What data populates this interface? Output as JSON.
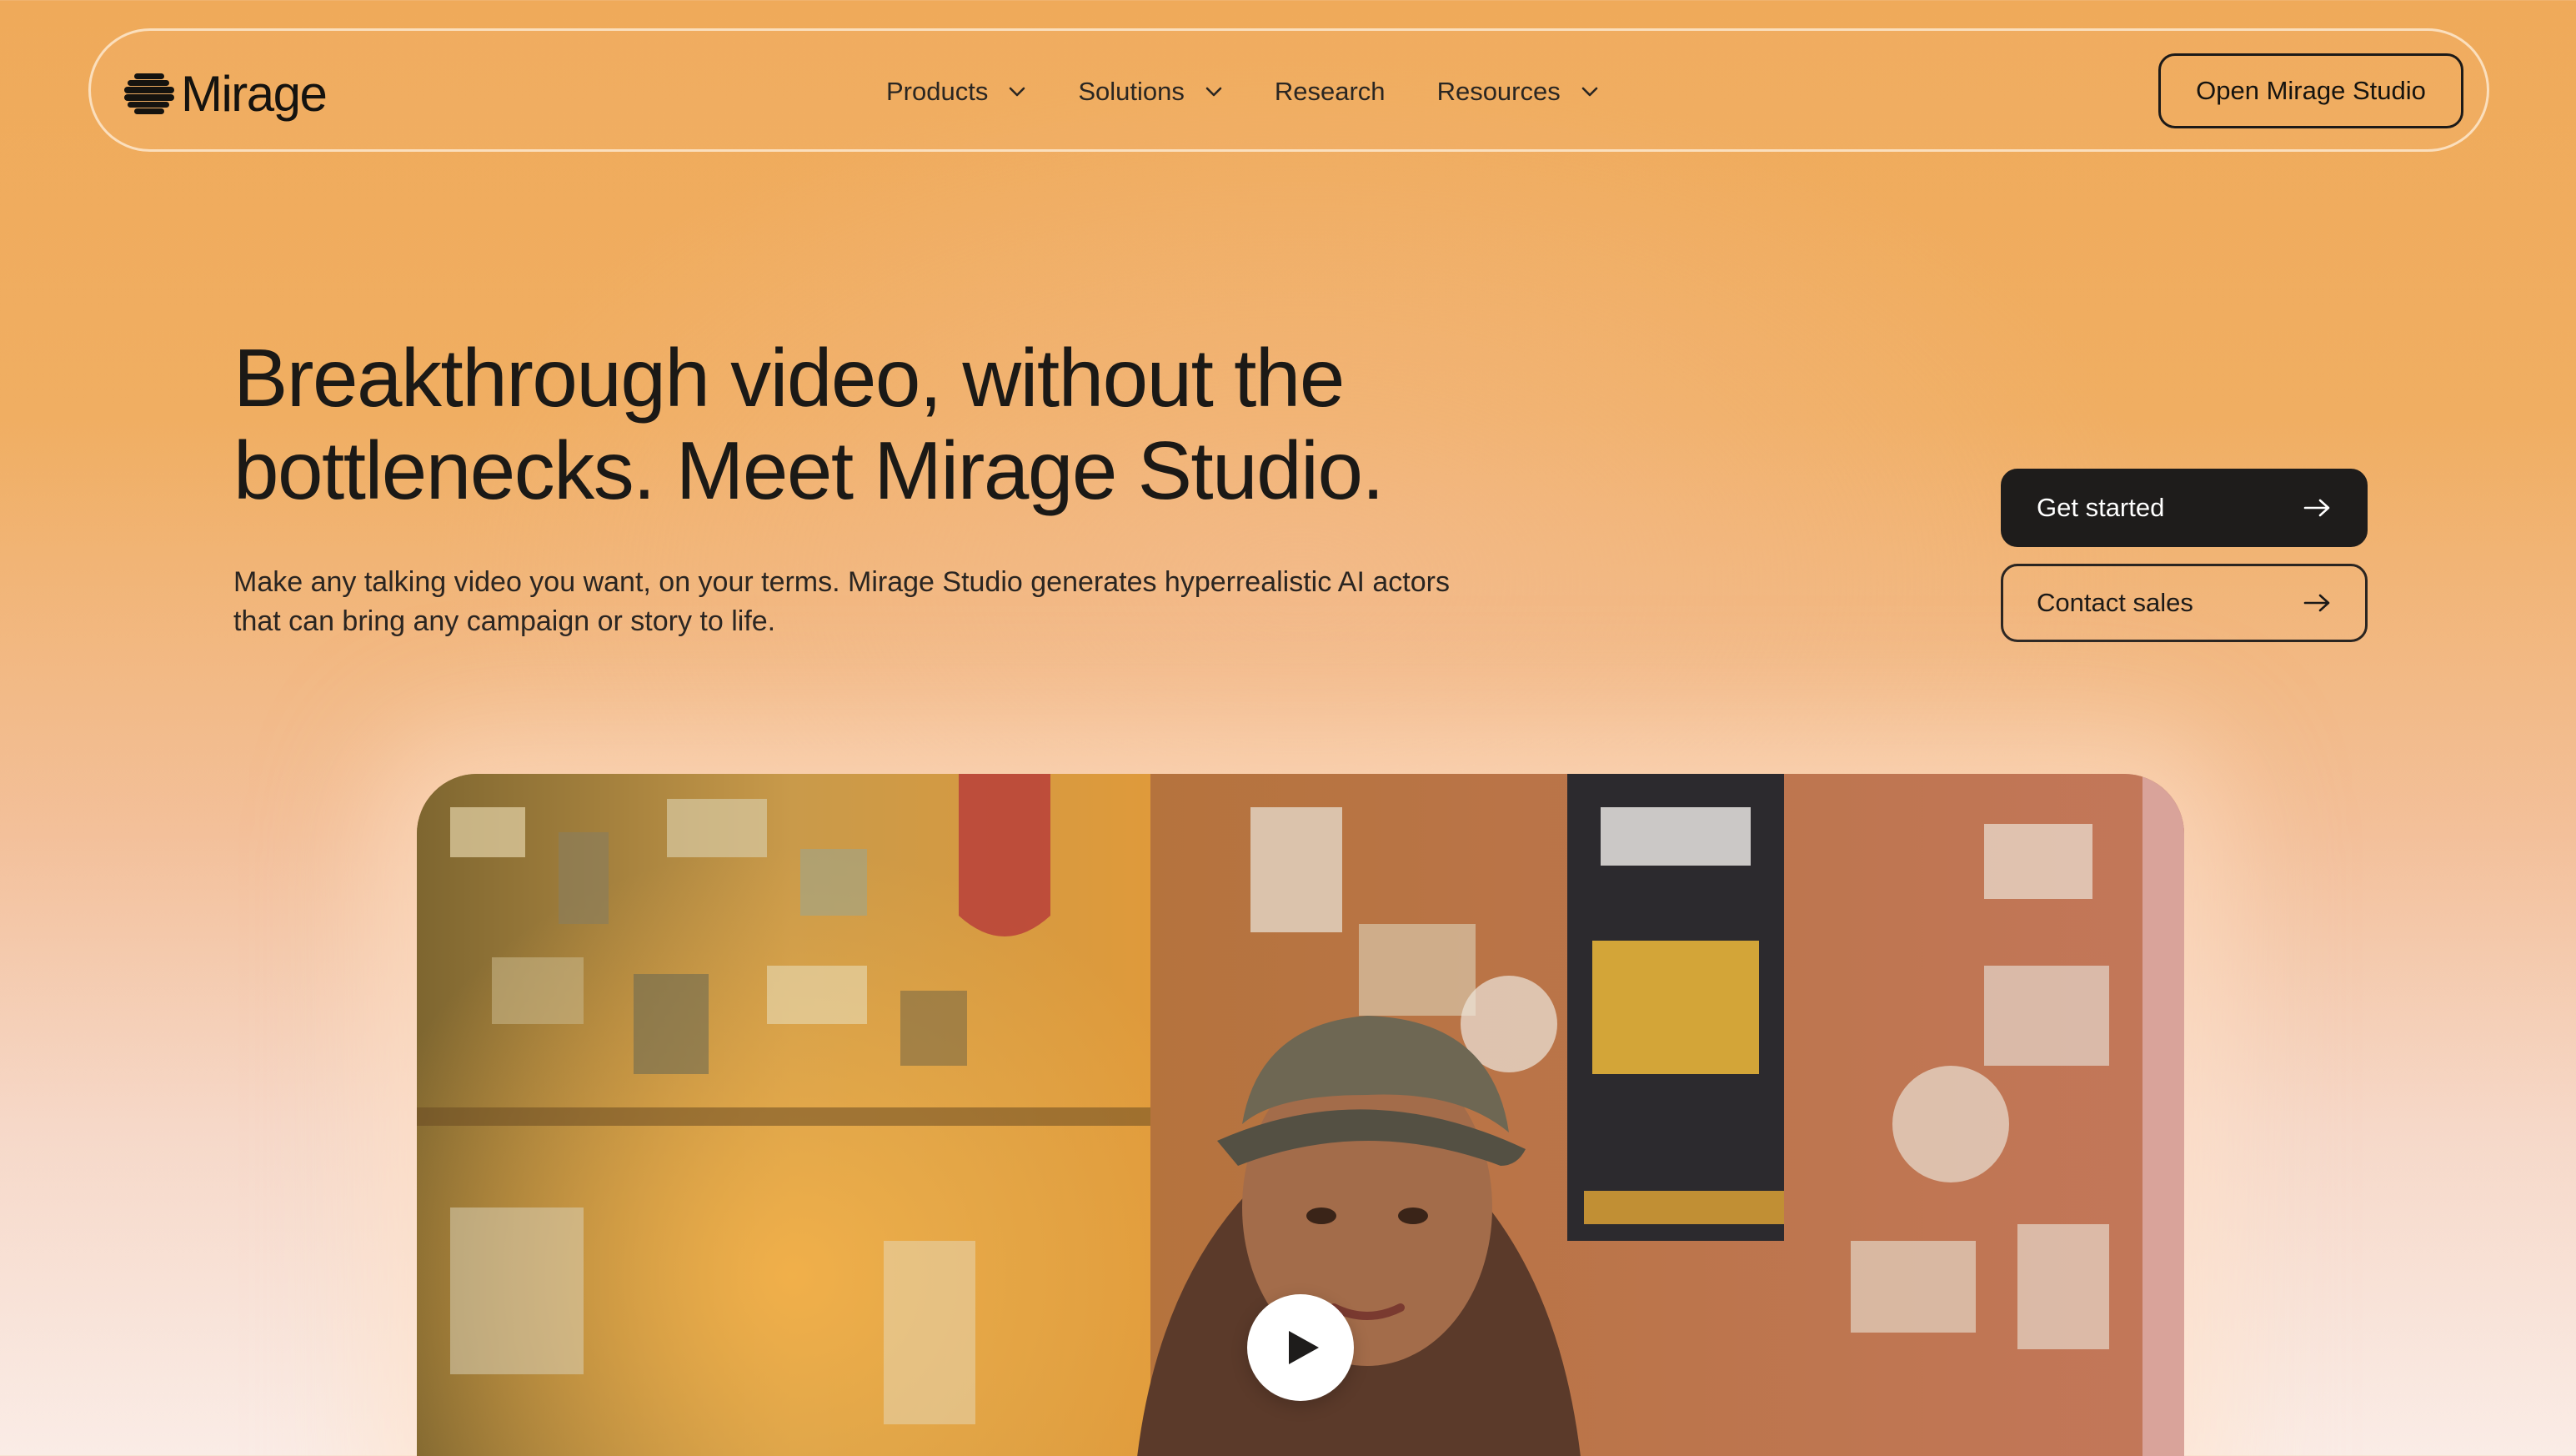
{
  "brand": {
    "name": "Mirage"
  },
  "nav": {
    "items": [
      {
        "label": "Products",
        "has_dropdown": true
      },
      {
        "label": "Solutions",
        "has_dropdown": true
      },
      {
        "label": "Research",
        "has_dropdown": false
      },
      {
        "label": "Resources",
        "has_dropdown": true
      }
    ],
    "cta_label": "Open Mirage Studio"
  },
  "hero": {
    "title_line1": "Breakthrough video, without the",
    "title_line2": "bottlenecks. Meet Mirage Studio.",
    "subtitle_line1": "Make any talking video you want, on your terms. Mirage Studio generates hyperrealistic AI actors",
    "subtitle_line2": "that can bring any campaign or story to life.",
    "primary_cta": "Get started",
    "secondary_cta": "Contact sales"
  },
  "video": {
    "play_icon": "play-icon"
  },
  "icons": {
    "logo": "mirage-logo-icon",
    "dropdown": "chevron-down-icon",
    "cta_arrow": "arrow-right-icon"
  },
  "colors": {
    "background_top": "#efaa5a",
    "background_bottom": "#faece6",
    "button_dark": "#1e1c1b",
    "text": "#1c1a18"
  }
}
